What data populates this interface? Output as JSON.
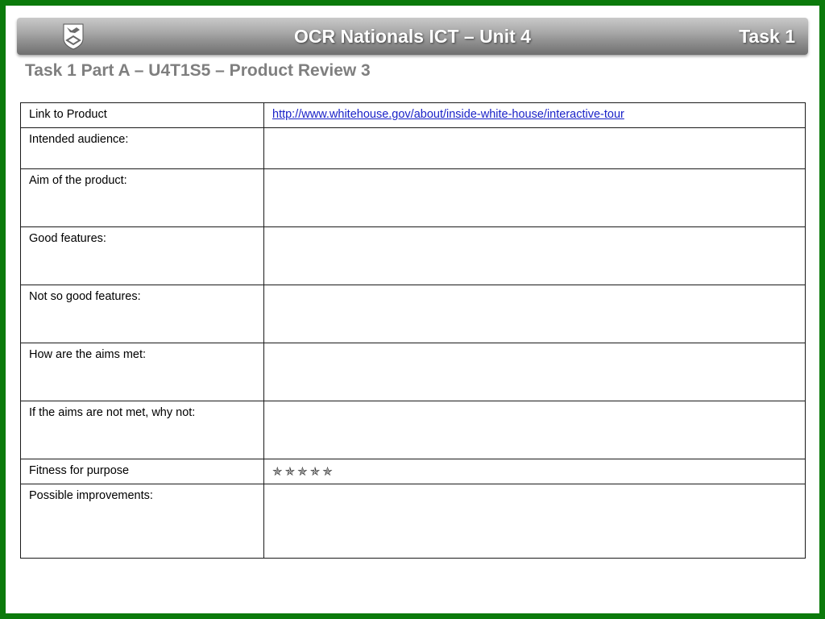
{
  "header": {
    "title": "OCR Nationals ICT – Unit 4",
    "task": "Task 1"
  },
  "page": {
    "title": "Task 1 Part A – U4T1S5 – Product Review 3"
  },
  "rows": {
    "link": {
      "label": "Link to Product",
      "value": "http://www.whitehouse.gov/about/inside-white-house/interactive-tour"
    },
    "audience": {
      "label": "Intended audience:",
      "value": ""
    },
    "aim": {
      "label": "Aim of the product:",
      "value": ""
    },
    "good": {
      "label": "Good features:",
      "value": ""
    },
    "not_good": {
      "label": "Not so good features:",
      "value": ""
    },
    "aims_met": {
      "label": "How are the aims met:",
      "value": ""
    },
    "aims_not_met": {
      "label": "If the aims are not met, why not:",
      "value": ""
    },
    "fitness": {
      "label": "Fitness for purpose",
      "value": "✯✯✯✯✯"
    },
    "improvements": {
      "label": "Possible improvements:",
      "value": ""
    }
  },
  "colors": {
    "border": "#0b7a0b",
    "title_grey": "#7f7f7f",
    "link": "#1a22c8"
  },
  "icons": {
    "logo": "school-crest-icon",
    "fitness_rating": "star-rating"
  }
}
